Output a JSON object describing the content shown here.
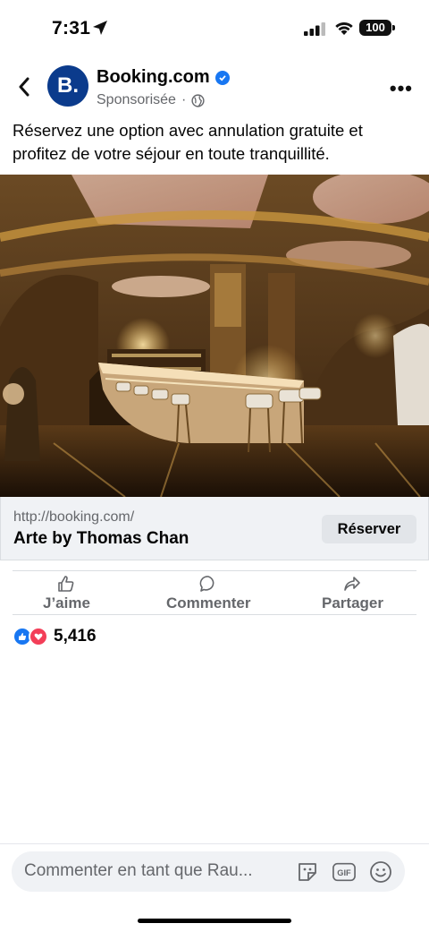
{
  "status_bar": {
    "time": "7:31",
    "battery": "100"
  },
  "post": {
    "page_name": "Booking.com",
    "avatar_letter": "B.",
    "sponsored": "Sponsorisée",
    "separator": "·",
    "text": "Réservez une option avec annulation gratuite et profitez de votre séjour en toute tranquillité."
  },
  "link": {
    "url": "http://booking.com/",
    "title": "Arte by Thomas Chan",
    "cta": "Réserver"
  },
  "actions": {
    "like": "J’aime",
    "comment": "Commenter",
    "share": "Partager"
  },
  "reactions": {
    "count": "5,416"
  },
  "composer": {
    "placeholder": "Commenter en tant que Rau...",
    "gif": "GIF"
  },
  "colors": {
    "accent": "#1877f2",
    "brand": "#0b3b8c",
    "love": "#f33e58"
  }
}
